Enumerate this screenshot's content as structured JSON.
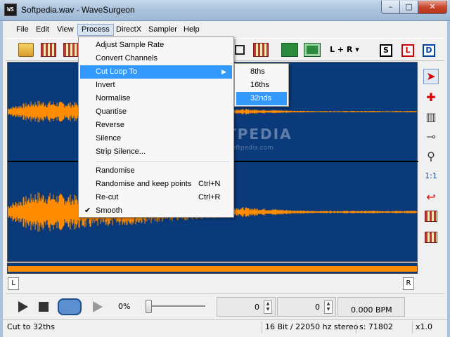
{
  "window": {
    "title": "Softpedia.wav - WaveSurgeon",
    "app_icon_text": "WS",
    "minimize": "–",
    "maximize": "□",
    "close": "✕"
  },
  "menubar": [
    "File",
    "Edit",
    "View",
    "Process",
    "DirectX",
    "Sampler",
    "Help"
  ],
  "toolbar": {
    "icons": [
      "open-folder-icon",
      "save-reel-icon",
      "midi-reel-icon",
      "crop-icon",
      "reel-icon",
      "chip-icon",
      "chip-icon"
    ],
    "channel_label": "L + R",
    "mode_buttons": [
      "S",
      "L",
      "D"
    ]
  },
  "process_menu": {
    "items": [
      {
        "label": "Adjust Sample Rate",
        "shortcut": ""
      },
      {
        "label": "Convert Channels",
        "shortcut": ""
      },
      {
        "label": "Cut Loop To",
        "shortcut": "",
        "submenu": true
      },
      {
        "label": "Invert",
        "shortcut": ""
      },
      {
        "label": "Normalise",
        "shortcut": ""
      },
      {
        "label": "Quantise",
        "shortcut": ""
      },
      {
        "label": "Reverse",
        "shortcut": ""
      },
      {
        "label": "Silence",
        "shortcut": ""
      },
      {
        "label": "Strip Silence...",
        "shortcut": ""
      },
      {
        "label": "Randomise",
        "shortcut": ""
      },
      {
        "label": "Randomise and keep points",
        "shortcut": "Ctrl+N"
      },
      {
        "label": "Re-cut",
        "shortcut": "Ctrl+R"
      },
      {
        "label": "Smooth",
        "shortcut": "",
        "checked": true
      }
    ],
    "submenu_items": [
      "8ths",
      "16ths",
      "32nds"
    ],
    "check_mark": "✔",
    "submenu_arrow": "▶"
  },
  "watermark": {
    "text": "SOFTPEDIA",
    "url": "www.softpedia.com"
  },
  "markers": {
    "left": "L",
    "right": "R"
  },
  "transport": {
    "position_percent": "0%",
    "value1": "0",
    "value2": "0",
    "bpm": "0.000 BPM"
  },
  "statusbar": {
    "message": "Cut to 32ths",
    "format": "16 Bit / 22050 hz stereo",
    "samples": "s: 71802",
    "zoom": "x1.0"
  },
  "colors": {
    "wave_bg": "#0a3a7a",
    "wave": "#ff8c00",
    "highlight": "#3399ff"
  }
}
